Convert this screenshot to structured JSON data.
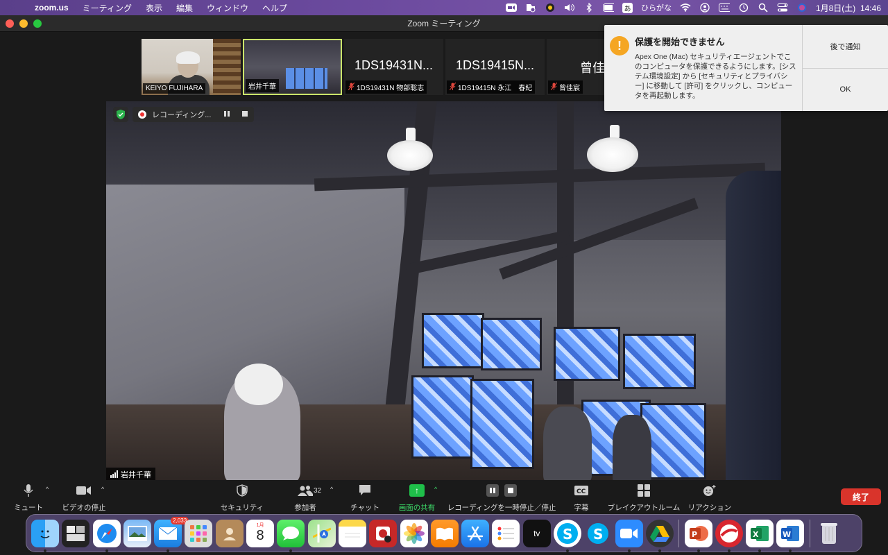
{
  "menubar": {
    "app": "zoom.us",
    "items": [
      "ミーティング",
      "表示",
      "編集",
      "ウィンドウ",
      "ヘルプ"
    ],
    "ime_char": "あ",
    "ime_label": "ひらがな",
    "datetime": "1月8日(土)  14:46"
  },
  "window": {
    "title": "Zoom ミーティング"
  },
  "thumbnails": [
    {
      "display": "",
      "label": "KEIYO FUJIHARA",
      "muted": false,
      "kind": "photo-a"
    },
    {
      "display": "",
      "label": "岩井千華",
      "muted": false,
      "kind": "photo-b"
    },
    {
      "display": "1DS19431N...",
      "label": "1DS19431N 物部聡志",
      "muted": true
    },
    {
      "display": "1DS19415N...",
      "label": "1DS19415N 永江　春紀",
      "muted": true
    },
    {
      "display": "曾佳宸",
      "label": "曾佳宸",
      "muted": true
    }
  ],
  "recording": {
    "label": "レコーディング..."
  },
  "main_video": {
    "speaker": "岩井千華"
  },
  "notification": {
    "title": "保護を開始できません",
    "body": "Apex One (Mac) セキュリティエージェントでこのコンピュータを保護できるようにします。[システム環境設定] から [セキュリティとプライバシー] に移動して [許可] をクリックし、コンピュータを再起動します。",
    "later": "後で通知",
    "ok": "OK"
  },
  "toolbar": {
    "mute": "ミュート",
    "video": "ビデオの停止",
    "security": "セキュリティ",
    "participants": "参加者",
    "participants_count": "32",
    "chat": "チャット",
    "share": "画面の共有",
    "rec": "レコーディングを一時停止／停止",
    "cc": "字幕",
    "breakout": "ブレイクアウトルーム",
    "reactions": "リアクション",
    "end": "終了"
  },
  "dock": {
    "mail_badge": "2,033",
    "calendar_month": "1月",
    "calendar_day": "8"
  }
}
